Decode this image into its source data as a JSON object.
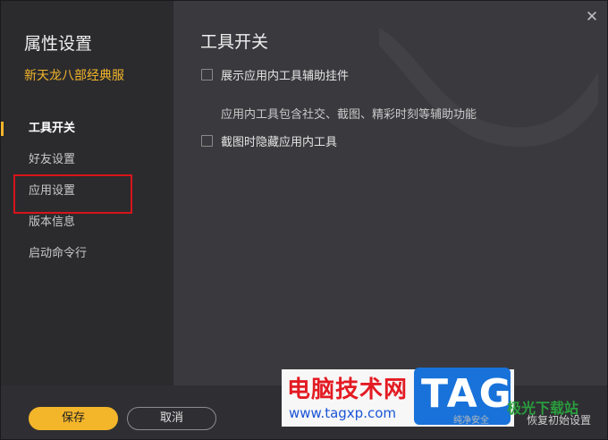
{
  "sidebar": {
    "title": "属性设置",
    "game_name": "新天龙八部经典服",
    "items": [
      {
        "label": "工具开关",
        "active": true
      },
      {
        "label": "好友设置",
        "active": false
      },
      {
        "label": "应用设置",
        "active": false
      },
      {
        "label": "版本信息",
        "active": false
      },
      {
        "label": "启动命令行",
        "active": false
      }
    ]
  },
  "main": {
    "title": "工具开关",
    "options": [
      {
        "label": "展示应用内工具辅助挂件",
        "checked": false
      },
      {
        "label": "截图时隐藏应用内工具",
        "checked": false
      }
    ],
    "description": "应用内工具包含社交、截图、精彩时刻等辅助功能"
  },
  "footer": {
    "save_label": "保存",
    "cancel_label": "取消",
    "restore_label": "恢复初始设置"
  },
  "icons": {
    "close": "close-icon"
  },
  "colors": {
    "accent": "#f3b52a",
    "highlight_box": "#d8141a",
    "sidebar_bg": "#2b2b2e",
    "main_bg": "#3a3a3e"
  },
  "watermark": {
    "title": "电脑技术网",
    "url": "www.tagxp.com",
    "tag": "TAG",
    "side_text": "极光下载站",
    "site_text": "纯净安全"
  }
}
